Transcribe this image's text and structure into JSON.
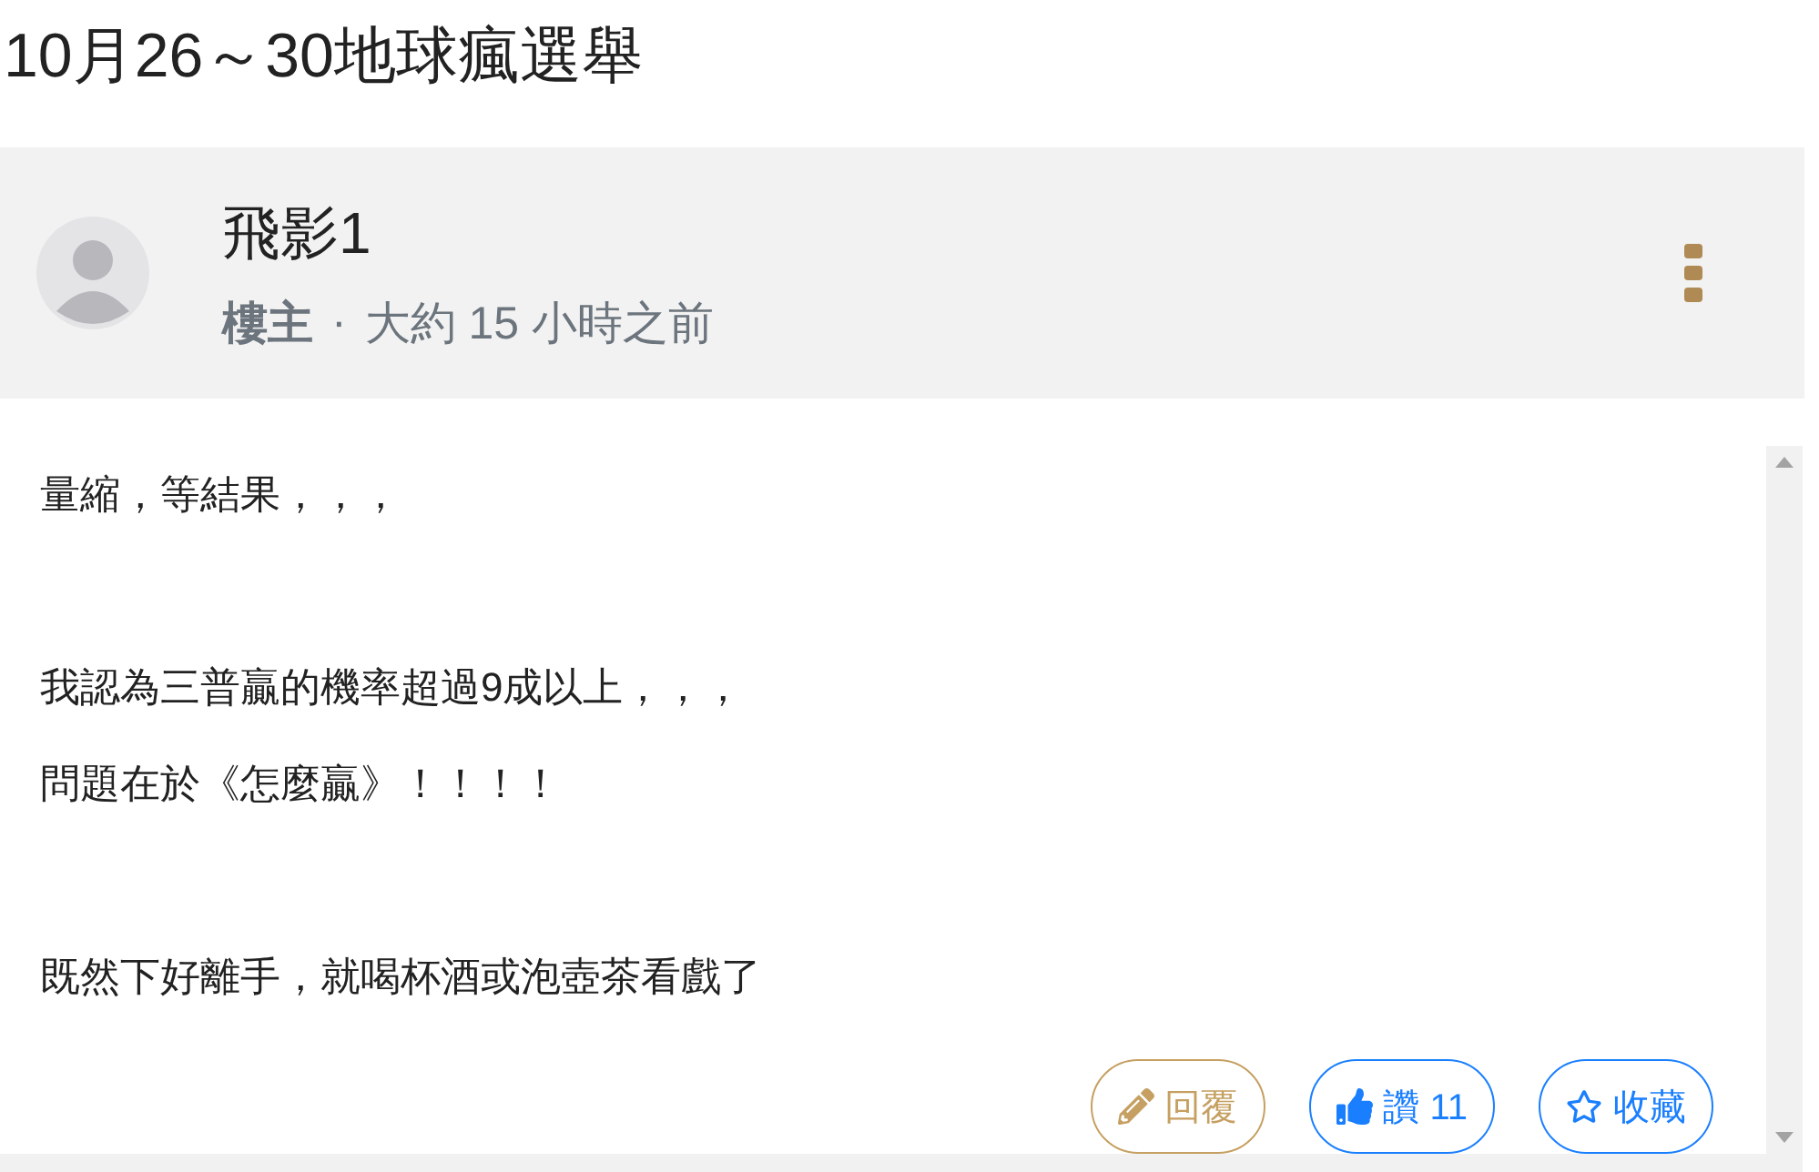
{
  "title": "10月26～30地球瘋選舉",
  "post": {
    "author": "飛影1",
    "role": "樓主",
    "separator": "·",
    "time": "大約 15 小時之前"
  },
  "body": [
    [
      "量縮，等結果，，，"
    ],
    [
      "我認為三普贏的機率超過9成以上，，，",
      "問題在於《怎麼贏》！！！！"
    ],
    [
      "既然下好離手，就喝杯酒或泡壺茶看戲了"
    ]
  ],
  "buttons": [
    {
      "kind": "reply",
      "label": "回覆"
    },
    {
      "kind": "like",
      "label": "讚 11"
    },
    {
      "kind": "favorite",
      "label": "收藏"
    }
  ]
}
